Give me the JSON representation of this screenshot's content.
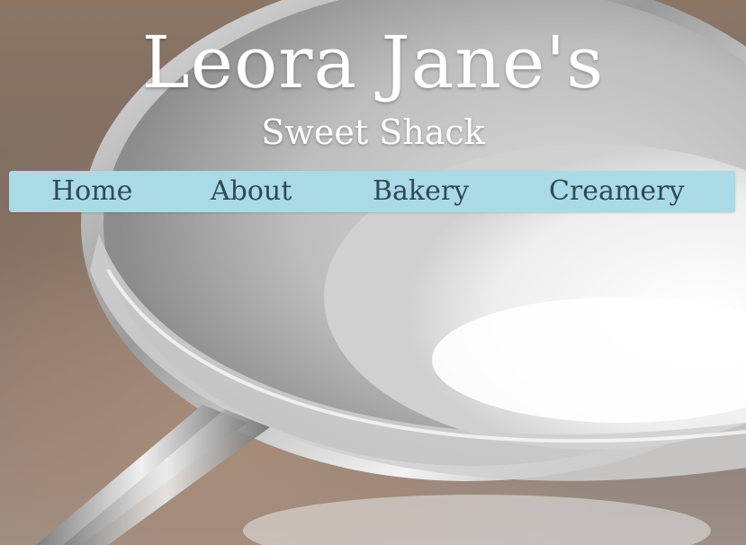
{
  "header": {
    "title": "Leora Jane's",
    "subtitle": "Sweet Shack"
  },
  "nav": {
    "items": [
      {
        "label": "Home"
      },
      {
        "label": "About"
      },
      {
        "label": "Bakery"
      },
      {
        "label": "Creamery"
      }
    ]
  },
  "colors": {
    "nav_background": "#a9dae6",
    "nav_text": "#2f4a55",
    "title_text": "#ffffff"
  }
}
